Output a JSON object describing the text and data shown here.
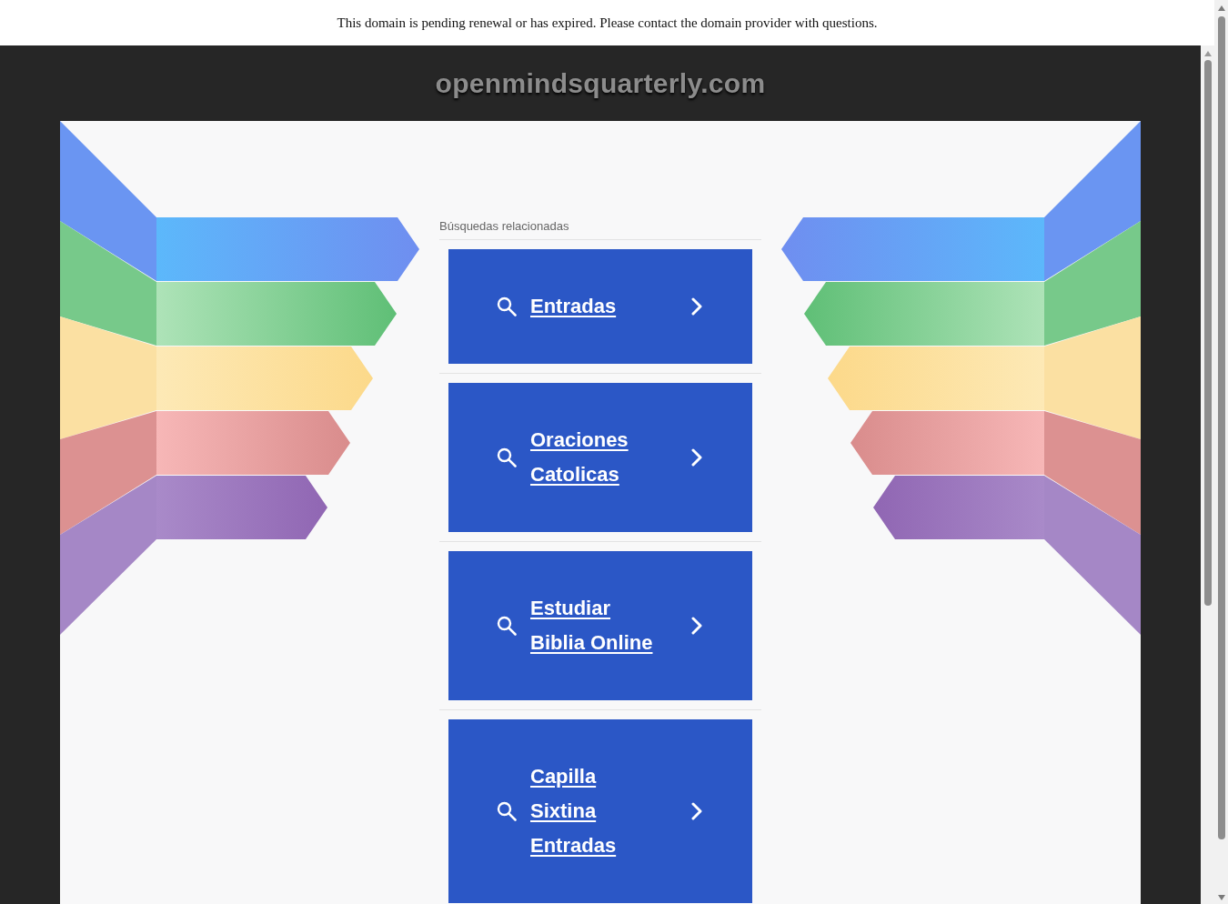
{
  "notice": {
    "text": "This domain is pending renewal or has expired. Please contact the domain provider with questions."
  },
  "header": {
    "domain": "openmindsquarterly.com"
  },
  "related": {
    "heading": "Búsquedas relacionadas",
    "items": [
      {
        "label": "Entradas"
      },
      {
        "label": "Oraciones Catolicas"
      },
      {
        "label": "Estudiar Biblia Online"
      },
      {
        "label": "Capilla Sixtina Entradas"
      }
    ]
  }
}
